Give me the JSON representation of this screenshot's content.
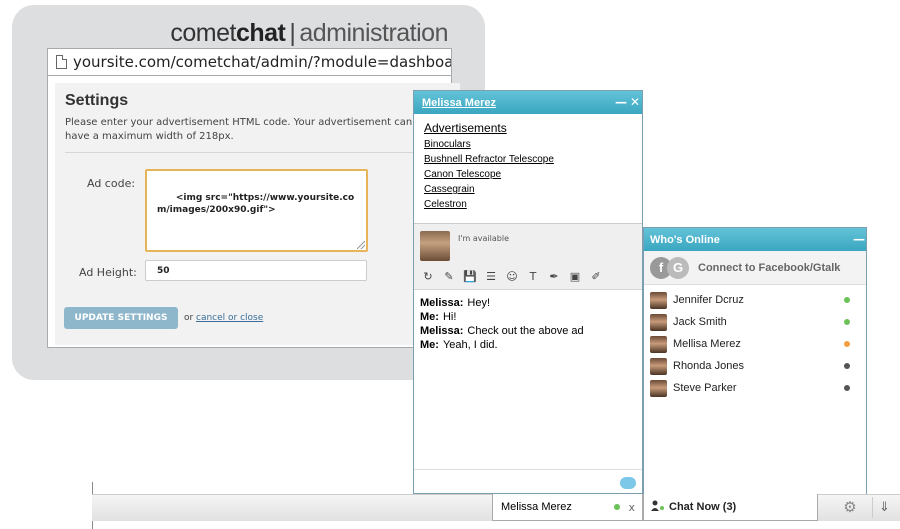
{
  "admin": {
    "logo_brand_light": "comet",
    "logo_brand_bold": "chat",
    "logo_separator": "|",
    "logo_suffix": "administration",
    "url": "yoursite.com/cometchat/admin/?module=dashboard&ac",
    "settings": {
      "title": "Settings",
      "description": "Please enter your advertisement HTML code. Your advertisement can have a maximum width of 218px.",
      "ad_code_label": "Ad code:",
      "ad_code_value": "<img src=\"https://www.yoursite.com/images/200x90.gif\">",
      "ad_height_label": "Ad Height:",
      "ad_height_value": "50",
      "update_label": "UPDATE SETTINGS",
      "or_text": "or",
      "cancel_label": "cancel or close"
    }
  },
  "chat": {
    "title": "Melissa Merez",
    "minimize_icon": "—",
    "close_icon": "✕",
    "ads_title": "Advertisements",
    "ads": [
      "Binoculars",
      "Bushnell Refractor Telescope",
      "Canon Telescope",
      "Cassegrain",
      "Celestron"
    ],
    "my_status": "I'm available",
    "tools": [
      "↻",
      "✎",
      "💾",
      "☰",
      "☺",
      "T",
      "✒",
      "▣",
      "✐"
    ],
    "messages": [
      {
        "sender": "Melissa:",
        "text": "Hey!"
      },
      {
        "sender": "Me:",
        "text": "Hi!"
      },
      {
        "sender": "Melissa:",
        "text": "Check out the above ad"
      },
      {
        "sender": "Me:",
        "text": "Yeah, I did."
      }
    ]
  },
  "online": {
    "title": "Who's Online",
    "minimize_icon": "—",
    "fb_letter_1": "f",
    "fb_letter_2": "G",
    "connect_label": "Connect to Facebook/Gtalk",
    "buddies": [
      {
        "name": "Jennifer Dcruz",
        "status_color": "#6ac259"
      },
      {
        "name": "Jack Smith",
        "status_color": "#6ac259"
      },
      {
        "name": "Mellisa Merez",
        "status_color": "#f0a040"
      },
      {
        "name": "Rhonda Jones",
        "status_color": "#555555"
      },
      {
        "name": "Steve Parker",
        "status_color": "#555555"
      }
    ]
  },
  "bar": {
    "chat_tab_name": "Melissa Merez",
    "chat_tab_close": "x",
    "chat_now_label": "Chat Now (3)",
    "gear_icon": "⚙",
    "collapse_icon": "⇓"
  },
  "colors": {
    "header_blue": "#3aa6c0",
    "button_blue": "#8fb7cb",
    "input_focus": "#e8b45a",
    "online_green": "#6ac259",
    "away_orange": "#f0a040"
  }
}
